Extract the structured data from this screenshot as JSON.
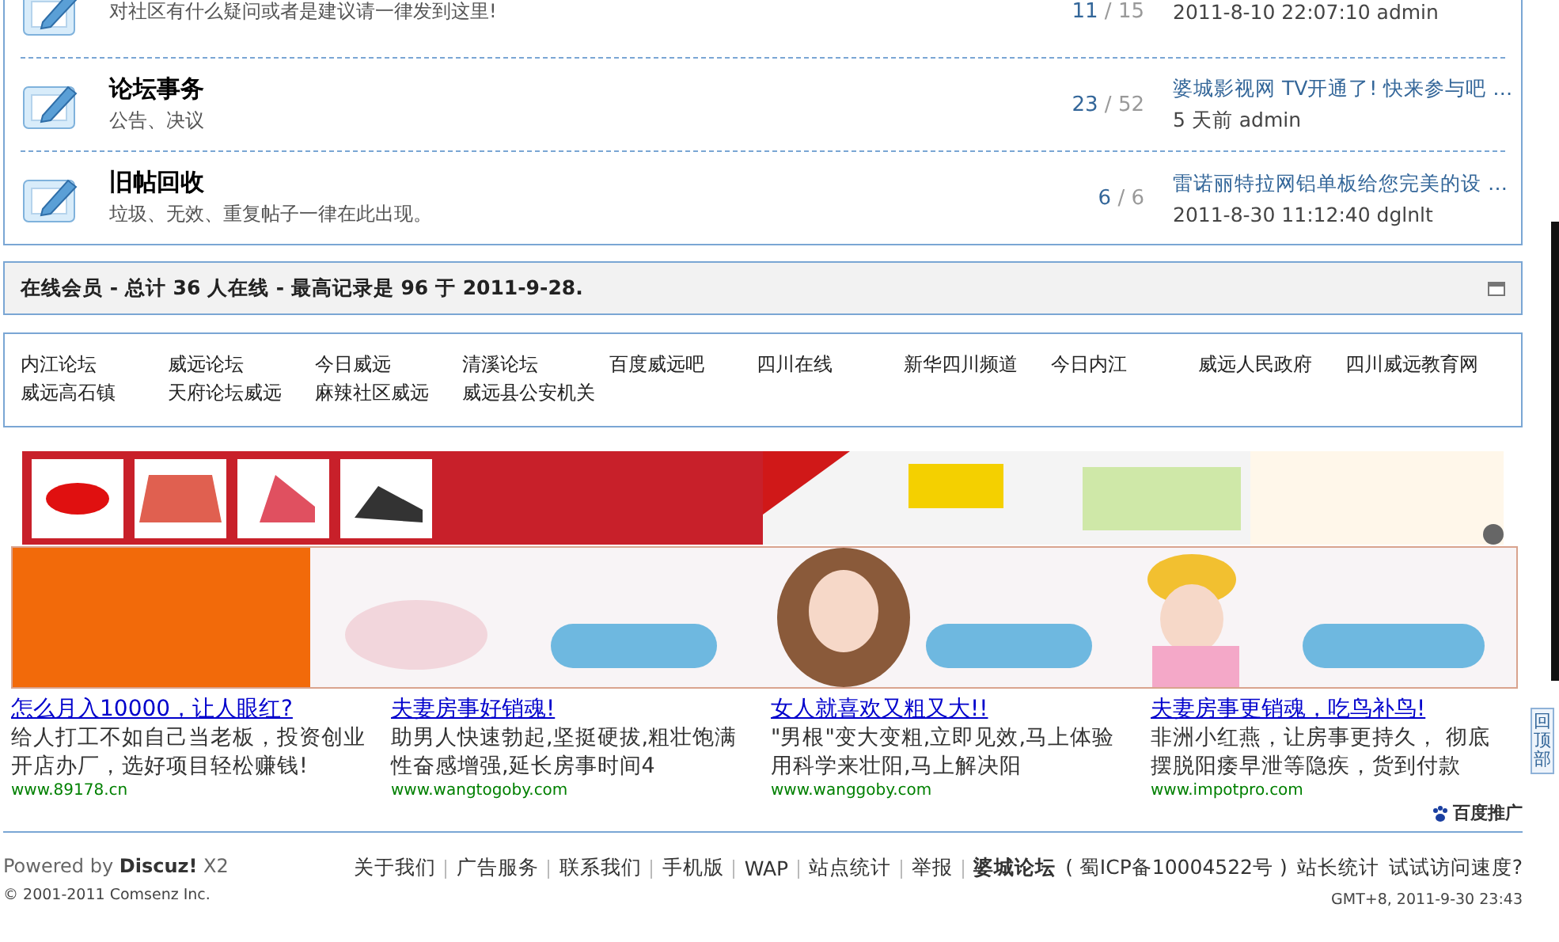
{
  "forums": [
    {
      "description": "对社区有什么疑问或者是建议请一律发到这里!",
      "topics": "11",
      "separator": "/",
      "posts": "15",
      "last_post_meta": "2011-8-10 22:07:10 admin"
    },
    {
      "title": "论坛事务",
      "description": "公告、决议",
      "topics": "23",
      "separator": "/",
      "posts": "52",
      "last_post_title": "婆城影视网 TV开通了! 快来参与吧 …",
      "last_post_meta": "5 天前  admin"
    },
    {
      "title": "旧帖回收",
      "description": "垃圾、无效、重复帖子一律在此出现。",
      "topics": "6",
      "separator": "/",
      "posts": "6",
      "last_post_title": "雷诺丽特拉网铝单板给您完美的设 …",
      "last_post_meta": "2011-8-30 11:12:40 dglnlt"
    }
  ],
  "online": {
    "summary": "在线会员 - 总计 36 人在线 - 最高记录是 96 于 2011-9-28."
  },
  "friend_links": [
    "内江论坛",
    "威远论坛",
    "今日威远",
    "清溪论坛",
    "百度威远吧",
    "四川在线",
    "新华四川频道",
    "今日内江",
    "威远人民政府",
    "四川威远教育网",
    "威远高石镇",
    "天府论坛威远",
    "麻辣社区威远",
    "威远县公安机关"
  ],
  "text_ads": [
    {
      "title": "怎么月入10000，让人眼红?",
      "body": "给人打工不如自己当老板，投资创业开店办厂，选好项目轻松赚钱!",
      "url": "www.89178.cn"
    },
    {
      "title": "夫妻房事好销魂!",
      "body": "助男人快速勃起,坚挺硬拔,粗壮饱满性奋感增强,延长房事时间4",
      "url": "www.wangtogoby.com"
    },
    {
      "title": "女人就喜欢又粗又大!!",
      "body": "\"男根\"变大变粗,立即见效,马上体验用科学来壮阳,马上解决阳",
      "url": "www.wanggoby.com"
    },
    {
      "title": "夫妻房事更销魂，吃鸟补鸟!",
      "body": "非洲小红燕，让房事更持久，  彻底摆脱阳痿早泄等隐疾，货到付款",
      "url": "www.impotpro.com"
    }
  ],
  "ad_brand": "百度推广",
  "back_to_top": "回顶部",
  "footer": {
    "powered": "Powered by **Discuz!** X2",
    "copyright": "© 2001-2011 Comsenz Inc.",
    "links": [
      {
        "text": "关于我们",
        "bold": false
      },
      {
        "text": "广告服务",
        "bold": false
      },
      {
        "text": "联系我们",
        "bold": false
      },
      {
        "text": "手机版",
        "bold": false
      },
      {
        "text": "WAP",
        "bold": false
      },
      {
        "text": "站点统计",
        "bold": false
      },
      {
        "text": "举报",
        "bold": false
      },
      {
        "text": "婆城论坛",
        "bold": true
      }
    ],
    "icp": "( 蜀ICP备10004522号 )",
    "stats": "站长统计",
    "speed": "试试访问速度?",
    "time": "GMT+8, 2011-9-30 23:43"
  }
}
